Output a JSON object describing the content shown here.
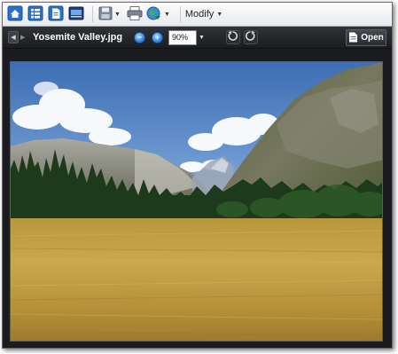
{
  "toolbar": {
    "buttons": [
      {
        "name": "home",
        "icon": "home-icon"
      },
      {
        "name": "browse",
        "icon": "list-view-icon"
      },
      {
        "name": "document",
        "icon": "document-icon"
      },
      {
        "name": "filmstrip",
        "icon": "slideshow-icon"
      }
    ],
    "save_icon": "save-icon",
    "print_icon": "print-icon",
    "share_icon": "globe-share-icon",
    "modify_label": "Modify"
  },
  "viewer": {
    "filename": "Yosemite Valley.jpg",
    "zoom_value": "90%",
    "zoom_out_symbol": "−",
    "zoom_in_symbol": "+",
    "open_label": "Open"
  },
  "colors": {
    "accent_blue": "#2a78d8",
    "viewer_background": "#1b1c1f",
    "toolbar_background": "#eef0f4"
  }
}
